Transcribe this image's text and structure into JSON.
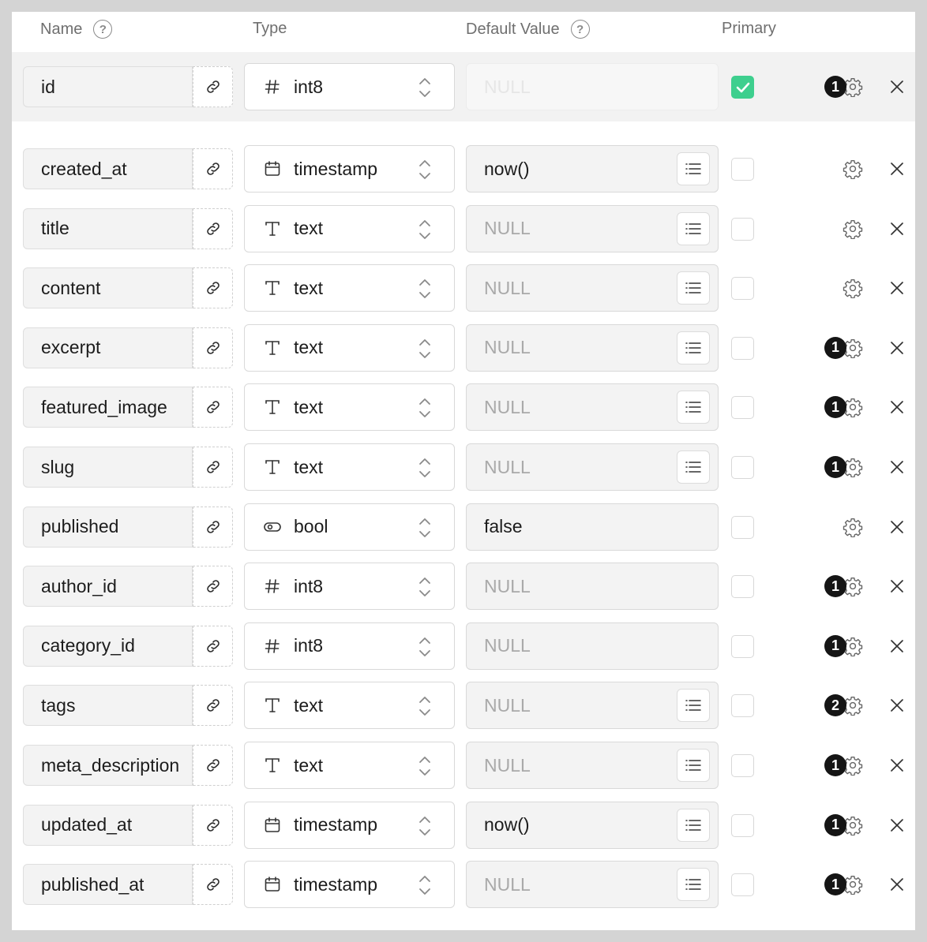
{
  "header": {
    "name_label": "Name",
    "type_label": "Type",
    "default_label": "Default Value",
    "primary_label": "Primary",
    "help_glyph": "?"
  },
  "columns": [
    {
      "name": "id",
      "type": "int8",
      "type_icon": "hash-icon",
      "default": "NULL",
      "default_is_null": true,
      "default_disabled": true,
      "has_list_button": false,
      "primary": true,
      "badge": "1"
    },
    {
      "name": "created_at",
      "type": "timestamp",
      "type_icon": "calendar-icon",
      "default": "now()",
      "default_is_null": false,
      "default_disabled": false,
      "has_list_button": true,
      "primary": false,
      "badge": ""
    },
    {
      "name": "title",
      "type": "text",
      "type_icon": "text-icon",
      "default": "NULL",
      "default_is_null": true,
      "default_disabled": false,
      "has_list_button": true,
      "primary": false,
      "badge": ""
    },
    {
      "name": "content",
      "type": "text",
      "type_icon": "text-icon",
      "default": "NULL",
      "default_is_null": true,
      "default_disabled": false,
      "has_list_button": true,
      "primary": false,
      "badge": ""
    },
    {
      "name": "excerpt",
      "type": "text",
      "type_icon": "text-icon",
      "default": "NULL",
      "default_is_null": true,
      "default_disabled": false,
      "has_list_button": true,
      "primary": false,
      "badge": "1"
    },
    {
      "name": "featured_image",
      "type": "text",
      "type_icon": "text-icon",
      "default": "NULL",
      "default_is_null": true,
      "default_disabled": false,
      "has_list_button": true,
      "primary": false,
      "badge": "1"
    },
    {
      "name": "slug",
      "type": "text",
      "type_icon": "text-icon",
      "default": "NULL",
      "default_is_null": true,
      "default_disabled": false,
      "has_list_button": true,
      "primary": false,
      "badge": "1"
    },
    {
      "name": "published",
      "type": "bool",
      "type_icon": "toggle-icon",
      "default": "false",
      "default_is_null": false,
      "default_disabled": false,
      "has_list_button": false,
      "primary": false,
      "badge": ""
    },
    {
      "name": "author_id",
      "type": "int8",
      "type_icon": "hash-icon",
      "default": "NULL",
      "default_is_null": true,
      "default_disabled": false,
      "has_list_button": false,
      "primary": false,
      "badge": "1"
    },
    {
      "name": "category_id",
      "type": "int8",
      "type_icon": "hash-icon",
      "default": "NULL",
      "default_is_null": true,
      "default_disabled": false,
      "has_list_button": false,
      "primary": false,
      "badge": "1"
    },
    {
      "name": "tags",
      "type": "text",
      "type_icon": "text-icon",
      "default": "NULL",
      "default_is_null": true,
      "default_disabled": false,
      "has_list_button": true,
      "primary": false,
      "badge": "2"
    },
    {
      "name": "meta_description",
      "type": "text",
      "type_icon": "text-icon",
      "default": "NULL",
      "default_is_null": true,
      "default_disabled": false,
      "has_list_button": true,
      "primary": false,
      "badge": "1"
    },
    {
      "name": "updated_at",
      "type": "timestamp",
      "type_icon": "calendar-icon",
      "default": "now()",
      "default_is_null": false,
      "default_disabled": false,
      "has_list_button": true,
      "primary": false,
      "badge": "1"
    },
    {
      "name": "published_at",
      "type": "timestamp",
      "type_icon": "calendar-icon",
      "default": "NULL",
      "default_is_null": true,
      "default_disabled": false,
      "has_list_button": true,
      "primary": false,
      "badge": "1"
    }
  ],
  "colors": {
    "accent_green": "#3ecf8e",
    "badge_bg": "#151515",
    "border": "#d9d9d9"
  }
}
